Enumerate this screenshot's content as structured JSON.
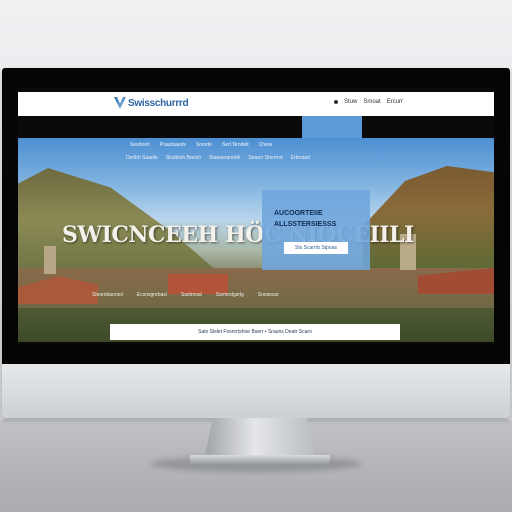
{
  "nav": {
    "brand": "Swisschurrrd",
    "links": [
      "Stuw",
      "Smoat",
      "Ercurr"
    ]
  },
  "hero": {
    "menu": [
      "Sesrlnoh",
      "Poastsaeds",
      "Snorde",
      "Sert Nrodelt",
      "Chere"
    ],
    "submenu": [
      "Derlbh Saadle",
      "Slodbloh Bretsh",
      "Stanaeranrelh",
      "Seaorr Shorrnd",
      "Erbrrasd"
    ],
    "title": "SWICNCEEH HÖC NIOCEIILI",
    "box_title": "AUCOORTEIIE ALLSSTERSIESSS",
    "box_button": "Sts Scarrrb Stpoas",
    "footer_items": [
      "Sleornbaorsol",
      "Ecsnsgnrbasl",
      "Sastrnsal",
      "Ssrmrolgsrlg",
      "Snosscar"
    ]
  },
  "bottom_bar": {
    "text": "Sats Stslet Fosnrrtshoe Bserr • Srauns Deatr Scaro"
  }
}
